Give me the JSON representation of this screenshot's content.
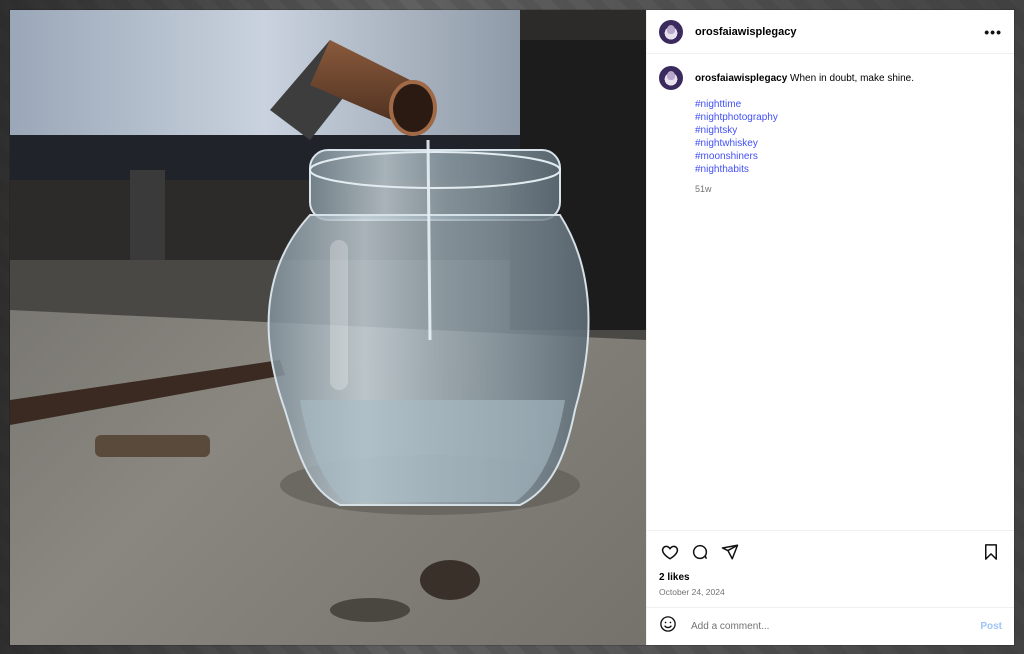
{
  "post": {
    "username": "orosfaiawisplegacy",
    "more_label": "•••",
    "caption": "When in doubt, make shine.",
    "hashtags": [
      "#nighttime",
      "#nightphotography",
      "#nightsky",
      "#nightwhiskey",
      "#moonshiners",
      "#nighthabits"
    ],
    "time_ago": "51w",
    "likes": "2 likes",
    "date": "October 24, 2024"
  },
  "actions": {
    "icons": [
      "heart-icon",
      "comment-icon",
      "share-icon",
      "bookmark-icon"
    ]
  },
  "comment_box": {
    "placeholder": "Add a comment...",
    "post_label": "Post",
    "post_color": "#9dc3f7"
  },
  "colors": {
    "hashtag": "#4150f7",
    "muted": "#737373"
  }
}
